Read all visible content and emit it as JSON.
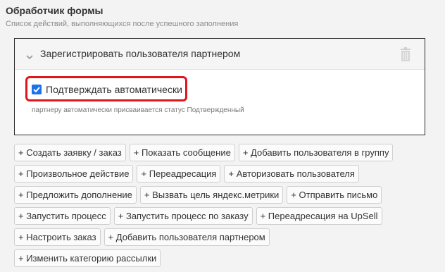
{
  "section": {
    "title": "Обработчик формы",
    "subtitle": "Список действий, выполняющихся после успешного заполнения"
  },
  "action": {
    "title": "Зарегистрировать пользователя партнером",
    "checkbox_label": "Подтверждать автоматически",
    "checkbox_checked": true,
    "hint": "партнеру автоматически присваивается статус Подтвержденный"
  },
  "buttons": {
    "row1": [
      "+ Создать заявку / заказ",
      "+ Показать сообщение",
      "+ Добавить пользователя в группу"
    ],
    "row2": [
      "+ Произвольное действие",
      "+ Переадресация",
      "+ Авторизовать пользователя"
    ],
    "row3": [
      "+ Предложить дополнение",
      "+ Вызвать цель яндекс.метрики",
      "+ Отправить письмо"
    ],
    "row4": [
      "+ Запустить процесс",
      "+ Запустить процесс по заказу",
      "+ Переадресация на UpSell"
    ],
    "row5": [
      "+ Настроить заказ",
      "+ Добавить пользователя партнером"
    ],
    "row6": [
      "+ Изменить категорию рассылки"
    ]
  },
  "colors": {
    "highlight": "#e0161c",
    "checkbox": "#1a73e8"
  },
  "icons": [
    "chevron-down-icon",
    "trash-icon",
    "checkmark-icon"
  ]
}
